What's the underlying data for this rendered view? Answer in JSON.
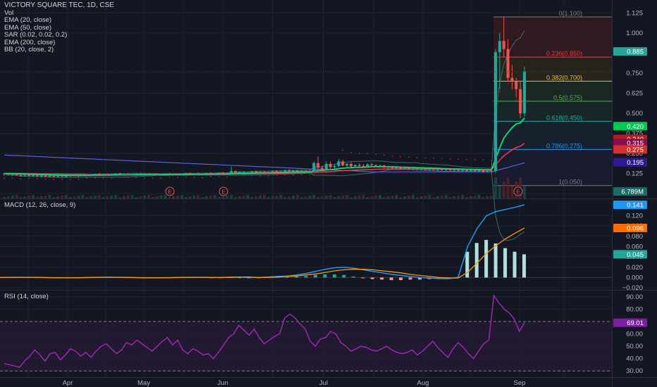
{
  "colors": {
    "background": "#131722",
    "grid": "#1f2330",
    "separator": "#2a2e39",
    "axis_text": "#b2b5be",
    "up": "#26a69a",
    "down": "#ef5350",
    "ema20": "#00e676",
    "ema50": "#f23645",
    "ema200": "#5b5fd6",
    "bb": "#3d6b6b",
    "sar": "#c2185b",
    "macd_line": "#2196f3",
    "signal_line": "#ff9800",
    "rsi_line": "#9c27b0",
    "rsi_band": "#2a1a3a"
  },
  "legend": {
    "symbol": "VICTORY SQUARE TEC, 1D, CSE",
    "items": [
      "Vol",
      "EMA (20, close)",
      "EMA (50, close)",
      "SAR (0.02, 0.02, 0.2)",
      "EMA (200, close)",
      "BB (20, close, 2)"
    ]
  },
  "price_axis": {
    "ticks": [
      "1.125",
      "1.000",
      "0.750",
      "0.625",
      "0.500",
      "0.375",
      "0.250",
      "0.125",
      "0.000"
    ],
    "tick_values": [
      1.125,
      1.0,
      0.75,
      0.625,
      0.5,
      0.375,
      0.25,
      0.125,
      0.0
    ],
    "badges": [
      {
        "label": "0.885",
        "value": 0.885,
        "color": "#26a69a"
      },
      {
        "label": "0.420",
        "value": 0.42,
        "color": "#00c853"
      },
      {
        "label": "0.340",
        "value": 0.34,
        "color": "#b71c1c"
      },
      {
        "label": "0.315",
        "value": 0.315,
        "color": "#880e4f"
      },
      {
        "label": "0.275",
        "value": 0.275,
        "color": "#d32f2f"
      },
      {
        "label": "0.195",
        "value": 0.195,
        "color": "#311b92"
      },
      {
        "label": "6.789M",
        "value": 0.013,
        "color": "#1e6a66"
      }
    ]
  },
  "fib_levels": [
    {
      "label": "0(1.100)",
      "value": 1.1,
      "color": "#787b86"
    },
    {
      "label": "0.236(0.850)",
      "value": 0.85,
      "color": "#f23645"
    },
    {
      "label": "0.382(0.700)",
      "value": 0.7,
      "color": "#e6c229"
    },
    {
      "label": "0.5(0.575)",
      "value": 0.575,
      "color": "#4caf50"
    },
    {
      "label": "0.618(0.450)",
      "value": 0.45,
      "color": "#26a69a"
    },
    {
      "label": "0.786(0.275)",
      "value": 0.275,
      "color": "#2196f3"
    },
    {
      "label": "1(0.050)",
      "value": 0.05,
      "color": "#787b86"
    }
  ],
  "earnings_marker": "E",
  "macd_panel": {
    "title": "MACD (12, 26, close, 9)",
    "ticks": [
      "0.120",
      "0.100",
      "0.080",
      "0.060",
      "0.040",
      "0.020",
      "0.000",
      "−0.020"
    ],
    "tick_values": [
      0.12,
      0.1,
      0.08,
      0.06,
      0.04,
      0.02,
      0.0,
      -0.02
    ],
    "badges": [
      {
        "label": "0.141",
        "value": 0.141,
        "color": "#2196f3"
      },
      {
        "label": "0.096",
        "value": 0.096,
        "color": "#ff6d00"
      },
      {
        "label": "0.045",
        "value": 0.045,
        "color": "#26a69a"
      }
    ]
  },
  "rsi_panel": {
    "title": "RSI (14, close)",
    "ticks": [
      "90.00",
      "80.00",
      "60.00",
      "50.00",
      "40.00",
      "30.00"
    ],
    "tick_values": [
      90,
      80,
      60,
      50,
      40,
      30
    ],
    "badges": [
      {
        "label": "69.01",
        "value": 69.01,
        "color": "#7b1fa2"
      }
    ]
  },
  "time_axis": {
    "labels": [
      "Apr",
      "May",
      "Jun",
      "Jul",
      "Aug",
      "Sep"
    ]
  },
  "chart_data": {
    "type": "candlestick",
    "title": "VICTORY SQUARE TEC, 1D, CSE",
    "ylim": [
      -0.03,
      1.17
    ],
    "candles": [
      [
        0.12,
        0.13,
        0.11,
        0.125
      ],
      [
        0.125,
        0.13,
        0.115,
        0.118
      ],
      [
        0.118,
        0.125,
        0.11,
        0.122
      ],
      [
        0.122,
        0.128,
        0.115,
        0.115
      ],
      [
        0.115,
        0.12,
        0.105,
        0.112
      ],
      [
        0.112,
        0.118,
        0.105,
        0.116
      ],
      [
        0.116,
        0.122,
        0.11,
        0.11
      ],
      [
        0.11,
        0.118,
        0.105,
        0.114
      ],
      [
        0.114,
        0.12,
        0.108,
        0.108
      ],
      [
        0.108,
        0.115,
        0.1,
        0.112
      ],
      [
        0.112,
        0.118,
        0.105,
        0.106
      ],
      [
        0.106,
        0.114,
        0.1,
        0.11
      ],
      [
        0.11,
        0.116,
        0.104,
        0.104
      ],
      [
        0.104,
        0.112,
        0.1,
        0.109
      ],
      [
        0.109,
        0.115,
        0.103,
        0.105
      ],
      [
        0.105,
        0.112,
        0.1,
        0.11
      ],
      [
        0.11,
        0.118,
        0.105,
        0.113
      ],
      [
        0.113,
        0.12,
        0.108,
        0.108
      ],
      [
        0.108,
        0.116,
        0.102,
        0.114
      ],
      [
        0.114,
        0.122,
        0.11,
        0.118
      ],
      [
        0.118,
        0.124,
        0.112,
        0.114
      ],
      [
        0.114,
        0.12,
        0.108,
        0.117
      ],
      [
        0.117,
        0.125,
        0.112,
        0.122
      ],
      [
        0.122,
        0.128,
        0.115,
        0.116
      ],
      [
        0.116,
        0.122,
        0.11,
        0.12
      ],
      [
        0.12,
        0.126,
        0.114,
        0.115
      ],
      [
        0.115,
        0.122,
        0.11,
        0.119
      ],
      [
        0.119,
        0.126,
        0.114,
        0.124
      ],
      [
        0.124,
        0.13,
        0.118,
        0.118
      ],
      [
        0.118,
        0.124,
        0.112,
        0.121
      ],
      [
        0.121,
        0.128,
        0.116,
        0.116
      ],
      [
        0.116,
        0.124,
        0.11,
        0.12
      ],
      [
        0.12,
        0.126,
        0.114,
        0.123
      ],
      [
        0.123,
        0.13,
        0.118,
        0.119
      ],
      [
        0.119,
        0.125,
        0.112,
        0.122
      ],
      [
        0.122,
        0.128,
        0.116,
        0.118
      ],
      [
        0.118,
        0.124,
        0.112,
        0.121
      ],
      [
        0.121,
        0.127,
        0.115,
        0.117
      ],
      [
        0.117,
        0.123,
        0.111,
        0.12
      ],
      [
        0.12,
        0.126,
        0.114,
        0.124
      ],
      [
        0.124,
        0.13,
        0.118,
        0.119
      ],
      [
        0.119,
        0.125,
        0.113,
        0.122
      ],
      [
        0.122,
        0.128,
        0.116,
        0.118
      ],
      [
        0.118,
        0.124,
        0.112,
        0.123
      ],
      [
        0.123,
        0.13,
        0.118,
        0.127
      ],
      [
        0.127,
        0.132,
        0.12,
        0.121
      ],
      [
        0.121,
        0.128,
        0.116,
        0.125
      ],
      [
        0.125,
        0.132,
        0.12,
        0.12
      ],
      [
        0.12,
        0.126,
        0.114,
        0.124
      ],
      [
        0.124,
        0.13,
        0.118,
        0.128
      ],
      [
        0.128,
        0.134,
        0.122,
        0.122
      ],
      [
        0.122,
        0.128,
        0.116,
        0.126
      ],
      [
        0.126,
        0.133,
        0.12,
        0.13
      ],
      [
        0.13,
        0.136,
        0.124,
        0.124
      ],
      [
        0.124,
        0.13,
        0.118,
        0.128
      ],
      [
        0.128,
        0.168,
        0.124,
        0.14
      ],
      [
        0.14,
        0.146,
        0.126,
        0.13
      ],
      [
        0.13,
        0.138,
        0.124,
        0.134
      ],
      [
        0.134,
        0.14,
        0.128,
        0.129
      ],
      [
        0.129,
        0.136,
        0.124,
        0.133
      ],
      [
        0.133,
        0.14,
        0.128,
        0.138
      ],
      [
        0.138,
        0.144,
        0.13,
        0.132
      ],
      [
        0.132,
        0.14,
        0.126,
        0.136
      ],
      [
        0.136,
        0.142,
        0.13,
        0.131
      ],
      [
        0.131,
        0.138,
        0.126,
        0.135
      ],
      [
        0.135,
        0.142,
        0.13,
        0.14
      ],
      [
        0.14,
        0.146,
        0.132,
        0.134
      ],
      [
        0.134,
        0.142,
        0.128,
        0.138
      ],
      [
        0.138,
        0.15,
        0.132,
        0.145
      ],
      [
        0.145,
        0.152,
        0.138,
        0.139
      ],
      [
        0.139,
        0.146,
        0.132,
        0.143
      ],
      [
        0.143,
        0.148,
        0.136,
        0.138
      ],
      [
        0.138,
        0.146,
        0.132,
        0.142
      ],
      [
        0.142,
        0.148,
        0.134,
        0.136
      ],
      [
        0.136,
        0.144,
        0.13,
        0.141
      ],
      [
        0.141,
        0.2,
        0.138,
        0.19
      ],
      [
        0.19,
        0.23,
        0.15,
        0.16
      ],
      [
        0.16,
        0.175,
        0.14,
        0.15
      ],
      [
        0.15,
        0.2,
        0.145,
        0.185
      ],
      [
        0.185,
        0.2,
        0.15,
        0.165
      ],
      [
        0.165,
        0.18,
        0.15,
        0.172
      ],
      [
        0.172,
        0.215,
        0.165,
        0.2
      ],
      [
        0.2,
        0.21,
        0.17,
        0.175
      ],
      [
        0.175,
        0.19,
        0.16,
        0.185
      ],
      [
        0.185,
        0.195,
        0.165,
        0.17
      ],
      [
        0.17,
        0.182,
        0.16,
        0.178
      ],
      [
        0.178,
        0.19,
        0.165,
        0.172
      ],
      [
        0.172,
        0.185,
        0.16,
        0.168
      ],
      [
        0.168,
        0.19,
        0.162,
        0.182
      ],
      [
        0.182,
        0.192,
        0.17,
        0.176
      ],
      [
        0.176,
        0.185,
        0.165,
        0.17
      ],
      [
        0.17,
        0.18,
        0.16,
        0.175
      ],
      [
        0.175,
        0.18,
        0.16,
        0.162
      ],
      [
        0.162,
        0.172,
        0.15,
        0.166
      ],
      [
        0.166,
        0.174,
        0.155,
        0.158
      ],
      [
        0.158,
        0.168,
        0.15,
        0.163
      ],
      [
        0.163,
        0.17,
        0.152,
        0.155
      ],
      [
        0.155,
        0.165,
        0.148,
        0.16
      ],
      [
        0.16,
        0.166,
        0.15,
        0.152
      ],
      [
        0.152,
        0.162,
        0.145,
        0.158
      ],
      [
        0.158,
        0.164,
        0.148,
        0.15
      ],
      [
        0.15,
        0.16,
        0.144,
        0.155
      ],
      [
        0.155,
        0.162,
        0.146,
        0.148
      ],
      [
        0.148,
        0.158,
        0.142,
        0.153
      ],
      [
        0.153,
        0.16,
        0.145,
        0.147
      ],
      [
        0.147,
        0.156,
        0.14,
        0.152
      ],
      [
        0.152,
        0.158,
        0.144,
        0.146
      ],
      [
        0.146,
        0.154,
        0.14,
        0.15
      ],
      [
        0.15,
        0.156,
        0.142,
        0.144
      ],
      [
        0.144,
        0.152,
        0.138,
        0.149
      ],
      [
        0.149,
        0.155,
        0.14,
        0.143
      ],
      [
        0.143,
        0.15,
        0.136,
        0.147
      ],
      [
        0.147,
        0.153,
        0.138,
        0.141
      ],
      [
        0.141,
        0.148,
        0.135,
        0.145
      ],
      [
        0.145,
        0.151,
        0.136,
        0.14
      ],
      [
        0.14,
        0.148,
        0.134,
        0.146
      ],
      [
        0.146,
        0.15,
        0.13,
        0.135
      ],
      [
        0.135,
        0.145,
        0.13,
        0.142
      ],
      [
        0.142,
        0.146,
        0.13,
        0.138
      ],
      [
        0.14,
        0.9,
        0.13,
        0.88
      ],
      [
        0.88,
        1.0,
        0.65,
        0.95
      ],
      [
        0.95,
        1.1,
        0.85,
        0.9
      ],
      [
        0.9,
        0.96,
        0.7,
        0.72
      ],
      [
        0.72,
        0.8,
        0.65,
        0.7
      ],
      [
        0.7,
        0.72,
        0.6,
        0.65
      ],
      [
        0.65,
        0.7,
        0.47,
        0.5
      ],
      [
        0.5,
        0.79,
        0.48,
        0.76
      ]
    ],
    "macd": [
      0.0,
      0.0,
      0.001,
      0.001,
      0.0,
      0.0,
      0.001,
      0.002,
      0.003,
      0.005,
      0.008,
      0.012,
      0.016,
      0.019,
      0.02,
      0.018,
      0.015,
      0.012,
      0.009,
      0.006,
      0.004,
      0.002,
      0.0,
      -0.001,
      -0.002,
      -0.002,
      0.0,
      0.06,
      0.095,
      0.12,
      0.128,
      0.132,
      0.136,
      0.141
    ],
    "signal": [
      0.0,
      0.0,
      0.0,
      0.001,
      0.001,
      0.0,
      0.0,
      0.001,
      0.002,
      0.003,
      0.005,
      0.007,
      0.01,
      0.013,
      0.015,
      0.016,
      0.016,
      0.015,
      0.013,
      0.011,
      0.009,
      0.006,
      0.004,
      0.002,
      0.0,
      -0.001,
      -0.001,
      0.01,
      0.028,
      0.047,
      0.062,
      0.075,
      0.086,
      0.096
    ],
    "rsi": [
      36,
      35,
      34,
      33,
      38,
      42,
      47,
      43,
      38,
      44,
      45,
      39,
      43,
      48,
      46,
      42,
      45,
      41,
      46,
      50,
      52,
      48,
      44,
      47,
      53,
      51,
      55,
      52,
      49,
      46,
      50,
      54,
      57,
      51,
      55,
      47,
      44,
      48,
      46,
      43,
      44,
      40,
      45,
      51,
      57,
      60,
      67,
      63,
      59,
      64,
      57,
      52,
      55,
      58,
      60,
      73,
      76,
      73,
      68,
      64,
      54,
      50,
      56,
      57,
      62,
      60,
      53,
      50,
      46,
      48,
      50,
      49,
      47,
      46,
      48,
      50,
      47,
      45,
      44,
      45,
      47,
      43,
      46,
      50,
      54,
      49,
      45,
      41,
      48,
      53,
      49,
      44,
      40,
      46,
      52,
      55,
      91,
      85,
      80,
      77,
      72,
      62,
      69
    ],
    "volume_days_label": "Vol"
  }
}
